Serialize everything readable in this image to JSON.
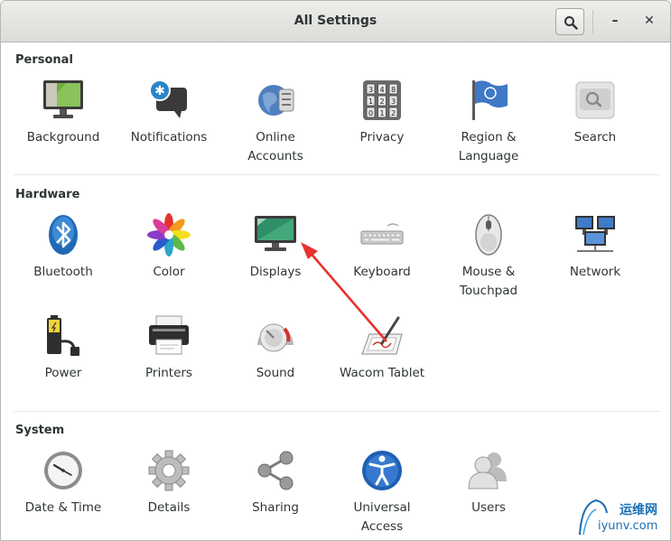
{
  "window": {
    "title": "All Settings",
    "search_button": "search-icon",
    "minimize": "–",
    "close": "✕"
  },
  "sections": {
    "personal": {
      "title": "Personal",
      "items": [
        {
          "label": "Background",
          "icon": "background-icon"
        },
        {
          "label": "Notifications",
          "icon": "notifications-icon"
        },
        {
          "label": "Online\nAccounts",
          "icon": "online-accounts-icon"
        },
        {
          "label": "Privacy",
          "icon": "privacy-icon"
        },
        {
          "label": "Region &\nLanguage",
          "icon": "region-language-icon"
        },
        {
          "label": "Search",
          "icon": "search-settings-icon"
        }
      ]
    },
    "hardware": {
      "title": "Hardware",
      "items": [
        {
          "label": "Bluetooth",
          "icon": "bluetooth-icon"
        },
        {
          "label": "Color",
          "icon": "color-icon"
        },
        {
          "label": "Displays",
          "icon": "displays-icon"
        },
        {
          "label": "Keyboard",
          "icon": "keyboard-icon"
        },
        {
          "label": "Mouse &\nTouchpad",
          "icon": "mouse-icon"
        },
        {
          "label": "Network",
          "icon": "network-icon"
        },
        {
          "label": "Power",
          "icon": "power-icon"
        },
        {
          "label": "Printers",
          "icon": "printer-icon"
        },
        {
          "label": "Sound",
          "icon": "sound-icon"
        },
        {
          "label": "Wacom Tablet",
          "icon": "wacom-tablet-icon"
        }
      ]
    },
    "system": {
      "title": "System",
      "items": [
        {
          "label": "Date & Time",
          "icon": "clock-icon"
        },
        {
          "label": "Details",
          "icon": "details-gear-icon"
        },
        {
          "label": "Sharing",
          "icon": "sharing-icon"
        },
        {
          "label": "Universal\nAccess",
          "icon": "universal-access-icon"
        },
        {
          "label": "Users",
          "icon": "users-icon"
        }
      ]
    }
  },
  "annotation": {
    "color": "#e8322c"
  },
  "watermark": {
    "text": "运维网",
    "url": "iyunv.com"
  }
}
